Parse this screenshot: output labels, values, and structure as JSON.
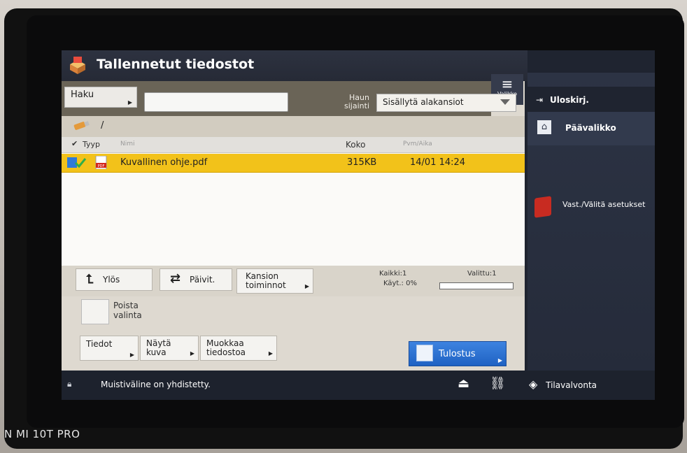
{
  "device_watermark": "N MI 10T PRO",
  "app": {
    "title": "Tallennetut tiedostot",
    "icon": "stored-files-icon"
  },
  "menu_button": {
    "label": "Valikko",
    "icon": "hamburger-icon"
  },
  "search": {
    "button_label": "Haku",
    "input_value": "",
    "location_label": "Haun sijainti",
    "location_value": "Sisällytä alakansiot"
  },
  "path": {
    "icon": "usb-icon",
    "text": "/"
  },
  "list": {
    "headers": {
      "type": "Tyyp",
      "name": "Nimi",
      "size": "Koko",
      "date": "Pvm/Aika"
    },
    "rows": [
      {
        "name": "Kuvallinen ohje.pdf",
        "size": "315KB",
        "date": "14/01 14:24",
        "selected": true
      }
    ]
  },
  "nav": {
    "up": "Ylös",
    "refresh": "Päivit.",
    "folder_ops": "Kansion toiminnot",
    "count_all": "Kaikki:1",
    "count_selected": "Valittu:1",
    "usage": "Käyt.: 0%",
    "usage_fraction": 0.0
  },
  "actions": {
    "deselect": "Poista valinta",
    "info": "Tiedot",
    "show_image": "Näytä kuva",
    "edit_files": "Muokkaa tiedostoa",
    "print": "Tulostus"
  },
  "status": {
    "message": "Muistiväline on yhdistetty.",
    "monitor": "Tilavalvonta"
  },
  "side": {
    "logout": "Uloskirj.",
    "home": "Päävalikko",
    "settings": "Vast./Välitä asetukset"
  },
  "colors": {
    "selected_row": "#f2c21a",
    "print_button": "#2f74d6",
    "sidebar": "#2c3344"
  }
}
